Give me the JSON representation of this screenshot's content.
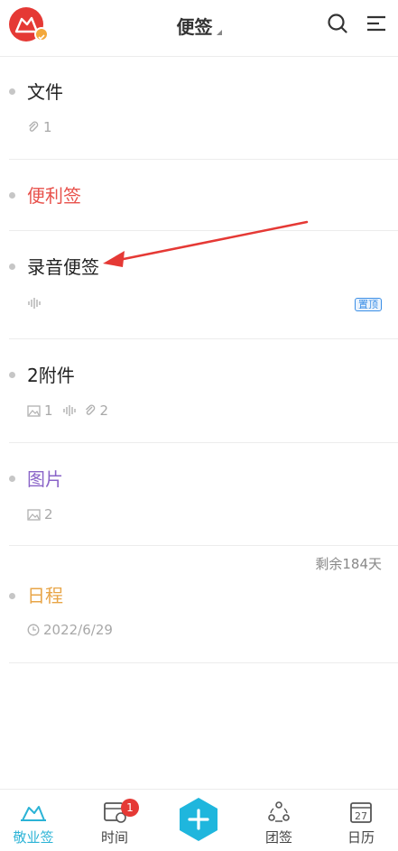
{
  "header": {
    "title": "便签"
  },
  "notes": [
    {
      "title": "文件",
      "attachments": "1"
    },
    {
      "title": "便利签"
    },
    {
      "title": "录音便签",
      "pin_label": "置顶"
    },
    {
      "title": "2附件",
      "images": "1",
      "attachments": "2"
    },
    {
      "title": "图片",
      "images": "2"
    },
    {
      "title": "日程",
      "date": "2022/6/29",
      "remaining": "剩余184天"
    }
  ],
  "colors": {
    "accent": "#2bb3d6",
    "red_title": "#e8514b",
    "purple_title": "#8a64c8",
    "orange_title": "#e8a547"
  },
  "tabs": [
    {
      "label": "敬业签",
      "icon": "cloud-icon"
    },
    {
      "label": "时间",
      "icon": "calendar-clock-icon",
      "badge": "1"
    },
    {
      "label": "团签",
      "icon": "team-icon"
    },
    {
      "label": "日历",
      "icon": "calendar-icon",
      "day": "27"
    }
  ]
}
